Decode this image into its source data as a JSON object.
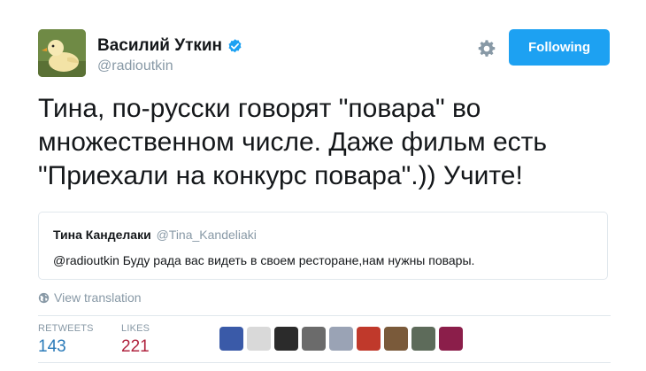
{
  "author": {
    "name": "Василий Уткин",
    "handle": "@radioutkin",
    "verified": true,
    "avatar_icon": "duckling-avatar"
  },
  "actions": {
    "follow_label": "Following",
    "settings_icon": "gear-icon"
  },
  "tweet": {
    "lines": [
      "Тина, по-русски говорят \"повара\" во",
      "множественном числе. Даже фильм есть",
      "\"Приехали на конкурс повара\".)) Учите!"
    ]
  },
  "quoted": {
    "name": "Тина Канделаки",
    "handle": "@Tina_Kandeliaki",
    "text": "@radioutkin Буду рада вас видеть в своем ресторане,нам нужны повары."
  },
  "translation": {
    "label": "View translation",
    "icon": "globe-icon"
  },
  "stats": {
    "retweets_label": "RETWEETS",
    "retweets_value": "143",
    "likes_label": "LIKES",
    "likes_value": "221"
  },
  "likers": [
    {
      "name": "liker-avatar-1",
      "color": "#3a5aa8"
    },
    {
      "name": "liker-avatar-2",
      "color": "#d9d9d9"
    },
    {
      "name": "liker-avatar-3",
      "color": "#2b2b2b"
    },
    {
      "name": "liker-avatar-4",
      "color": "#6b6b6b"
    },
    {
      "name": "liker-avatar-5",
      "color": "#9aa3b5"
    },
    {
      "name": "liker-avatar-6",
      "color": "#c0392b"
    },
    {
      "name": "liker-avatar-7",
      "color": "#7a5a3a"
    },
    {
      "name": "liker-avatar-8",
      "color": "#5d6b5a"
    },
    {
      "name": "liker-avatar-9",
      "color": "#8b1e4a"
    }
  ],
  "colors": {
    "accent": "#1da1f2",
    "link": "#2b7bb9",
    "muted": "#8899a6",
    "retweets_value": "#2b7bb9",
    "likes_value": "#b0243f"
  }
}
